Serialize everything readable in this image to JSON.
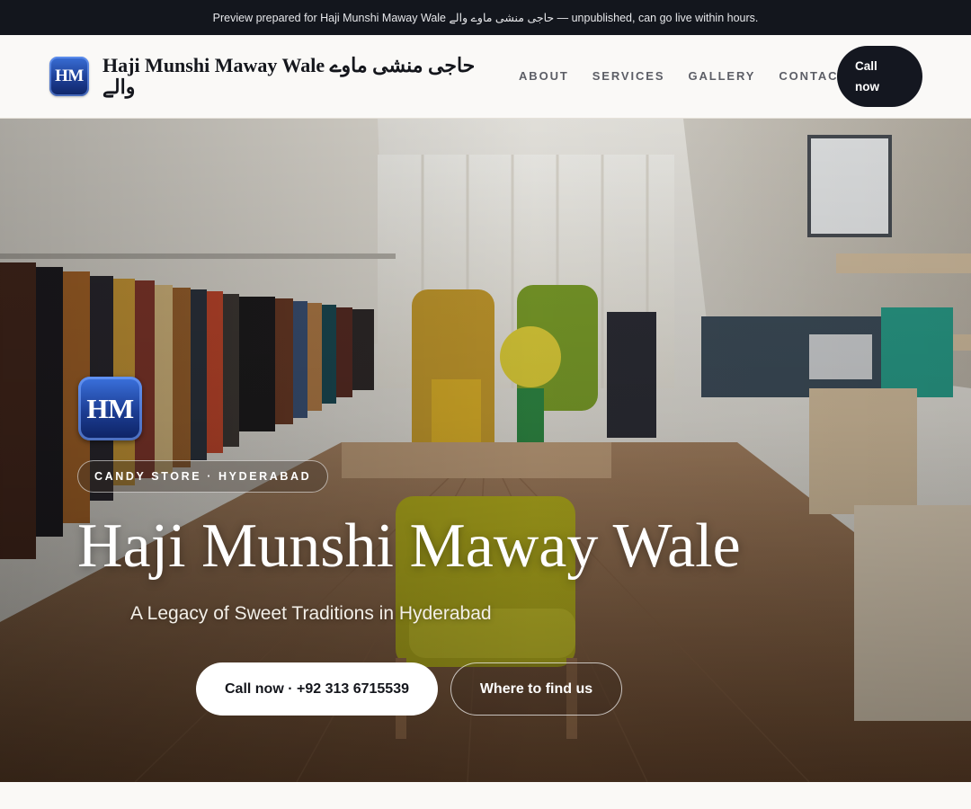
{
  "banner": {
    "text": "Preview prepared for Haji Munshi Maway Wale حاجی منشی ماوے والے — unpublished, can go live within hours."
  },
  "header": {
    "logo_initials": "HM",
    "brand_name": "Haji Munshi Maway Wale حاجی منشی ماوے والے",
    "nav": [
      "ABOUT",
      "SERVICES",
      "GALLERY",
      "CONTACT"
    ],
    "call_button": "Call now"
  },
  "hero": {
    "logo_initials": "HM",
    "tag": "CANDY STORE · HYDERABAD",
    "title": "Haji Munshi Maway Wale",
    "subtitle": "A Legacy of Sweet Traditions in Hyderabad",
    "primary_button": "Call now · +92 313 6715539",
    "secondary_button": "Where to find us"
  },
  "colors": {
    "banner_bg": "#13161d",
    "header_bg": "#faf9f7",
    "call_button_bg": "#141720",
    "logo_blue": "#1d3f95",
    "hero_text": "#ffffff"
  }
}
